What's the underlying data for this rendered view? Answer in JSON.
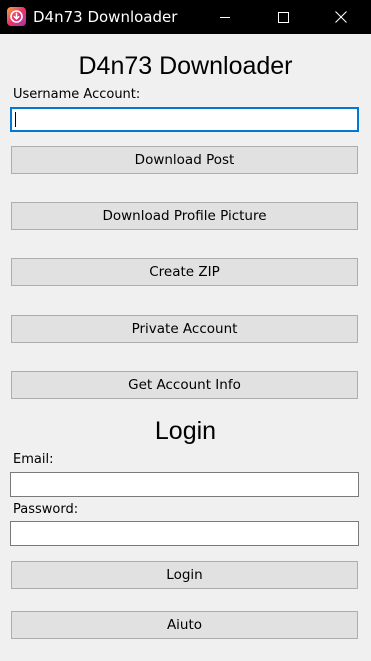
{
  "window": {
    "title": "D4n73 Downloader",
    "icon": "instagram-download-icon",
    "controls": [
      "minimize-icon",
      "maximize-icon",
      "close-icon"
    ]
  },
  "main": {
    "heading": "D4n73 Downloader",
    "username_label": "Username Account:",
    "username_value": "",
    "buttons": {
      "download_post": "Download Post",
      "download_profile_picture": "Download Profile Picture",
      "create_zip": "Create ZIP",
      "private_account": "Private Account",
      "get_account_info": "Get Account Info"
    }
  },
  "login": {
    "heading": "Login",
    "email_label": "Email:",
    "email_value": "",
    "password_label": "Password:",
    "password_value": "",
    "login_button": "Login",
    "help_button": "Aiuto"
  },
  "colors": {
    "titlebar": "#000000",
    "window_bg": "#f0f0f0",
    "button_bg": "#e1e1e1",
    "button_border": "#adadad",
    "focus_border": "#0078d7"
  }
}
